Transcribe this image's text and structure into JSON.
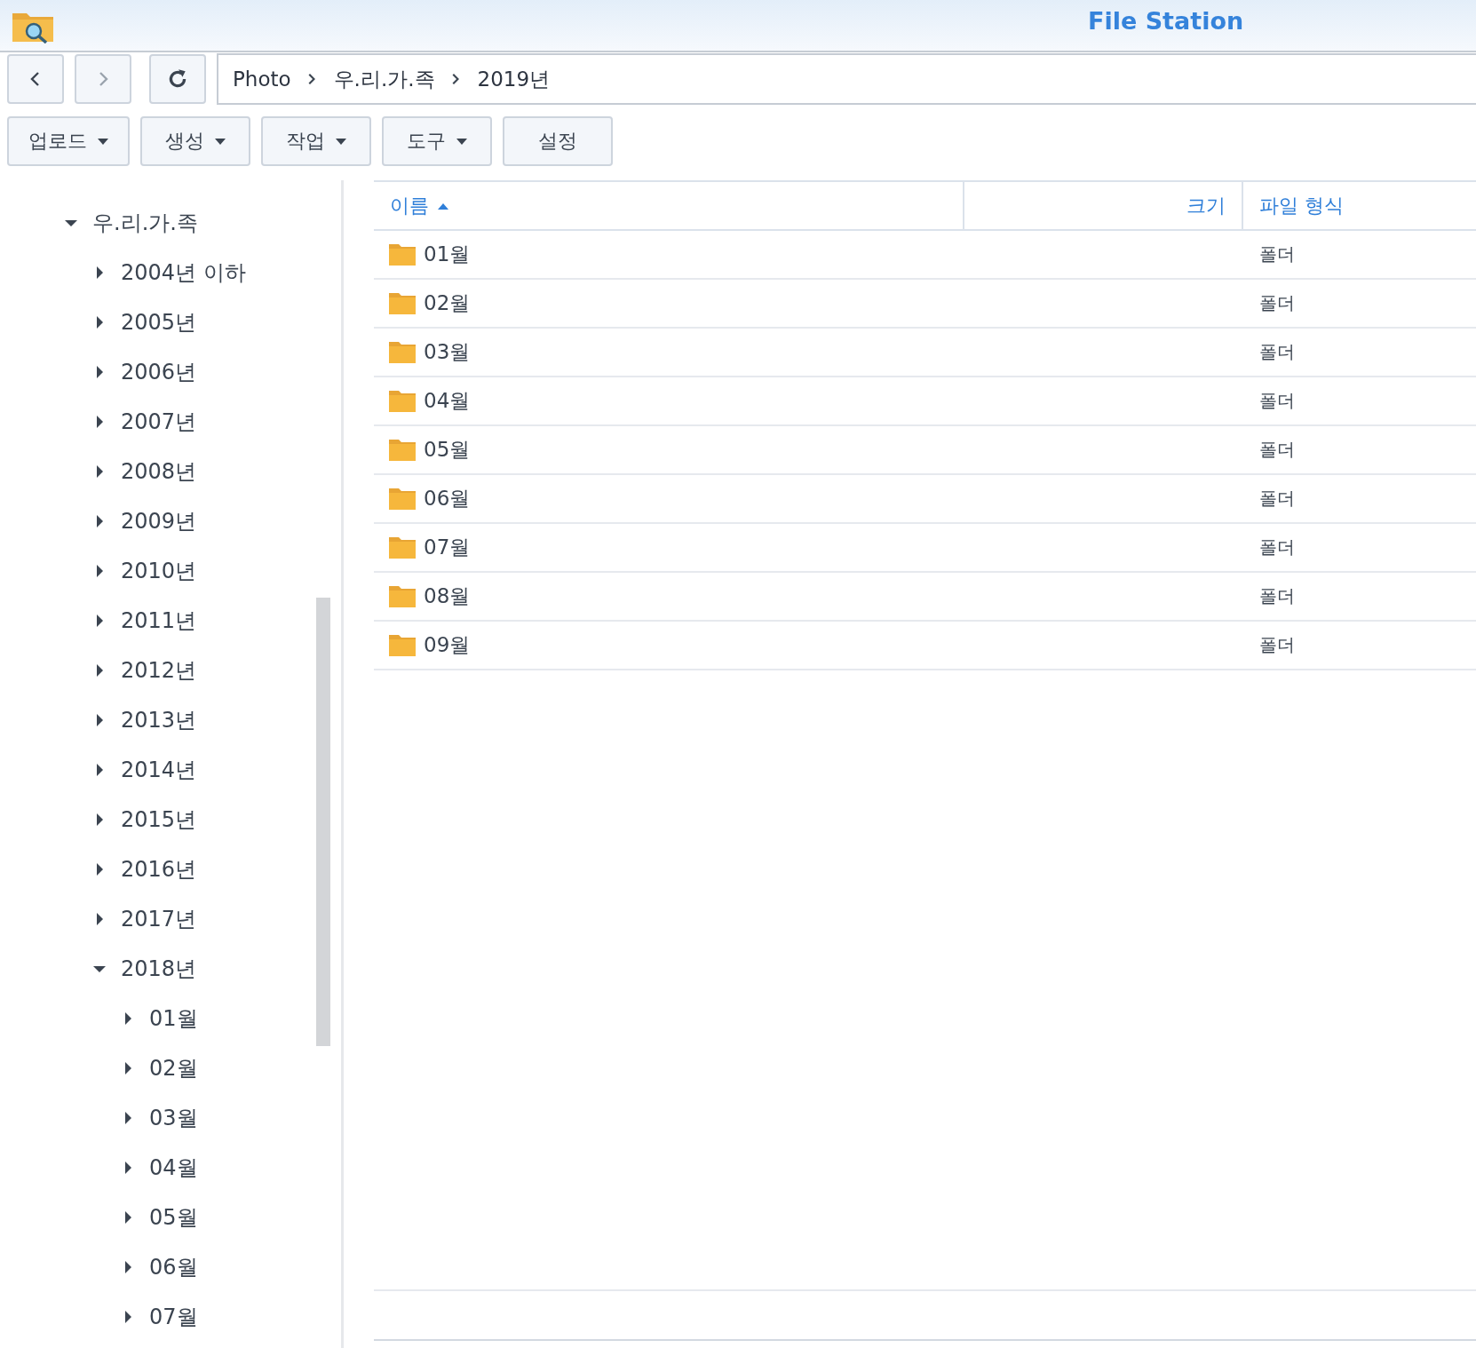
{
  "window": {
    "title": "File Station"
  },
  "nav": {
    "path": [
      {
        "label": "Photo"
      },
      {
        "label": "우.리.가.족"
      },
      {
        "label": "2019년"
      }
    ]
  },
  "toolbar": [
    {
      "label": "업로드",
      "dropdown": true
    },
    {
      "label": "생성",
      "dropdown": true
    },
    {
      "label": "작업",
      "dropdown": true
    },
    {
      "label": "도구",
      "dropdown": true
    },
    {
      "label": "설정",
      "dropdown": false
    }
  ],
  "tree": [
    {
      "label": "우.리.가.족",
      "expanded": true,
      "children": [
        {
          "label": "2004년 이하",
          "expanded": false
        },
        {
          "label": "2005년",
          "expanded": false
        },
        {
          "label": "2006년",
          "expanded": false
        },
        {
          "label": "2007년",
          "expanded": false
        },
        {
          "label": "2008년",
          "expanded": false
        },
        {
          "label": "2009년",
          "expanded": false
        },
        {
          "label": "2010년",
          "expanded": false
        },
        {
          "label": "2011년",
          "expanded": false
        },
        {
          "label": "2012년",
          "expanded": false
        },
        {
          "label": "2013년",
          "expanded": false
        },
        {
          "label": "2014년",
          "expanded": false
        },
        {
          "label": "2015년",
          "expanded": false
        },
        {
          "label": "2016년",
          "expanded": false
        },
        {
          "label": "2017년",
          "expanded": false
        },
        {
          "label": "2018년",
          "expanded": true,
          "children": [
            {
              "label": "01월",
              "expanded": false
            },
            {
              "label": "02월",
              "expanded": false
            },
            {
              "label": "03월",
              "expanded": false
            },
            {
              "label": "04월",
              "expanded": false
            },
            {
              "label": "05월",
              "expanded": false
            },
            {
              "label": "06월",
              "expanded": false
            },
            {
              "label": "07월",
              "expanded": false
            }
          ]
        }
      ]
    }
  ],
  "table": {
    "columns": [
      {
        "label": "이름",
        "sorted": true
      },
      {
        "label": "크기",
        "sorted": false
      },
      {
        "label": "파일 형식",
        "sorted": false
      }
    ],
    "rows": [
      {
        "name": "01월",
        "type": "폴더"
      },
      {
        "name": "02월",
        "type": "폴더"
      },
      {
        "name": "03월",
        "type": "폴더"
      },
      {
        "name": "04월",
        "type": "폴더"
      },
      {
        "name": "05월",
        "type": "폴더"
      },
      {
        "name": "06월",
        "type": "폴더"
      },
      {
        "name": "07월",
        "type": "폴더"
      },
      {
        "name": "08월",
        "type": "폴더"
      },
      {
        "name": "09월",
        "type": "폴더"
      }
    ]
  }
}
